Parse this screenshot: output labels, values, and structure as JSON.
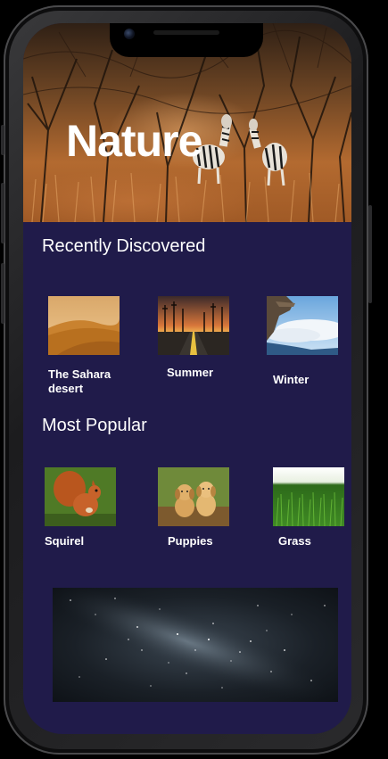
{
  "hero": {
    "title": "Nature",
    "image_icon": "savanna-zebras-image"
  },
  "recently_discovered": {
    "title": "Recently Discovered",
    "items": [
      {
        "label": "The Sahara\n desert",
        "image_icon": "desert-dunes-image"
      },
      {
        "label": "Summer",
        "image_icon": "sunset-road-image"
      },
      {
        "label": "Winter",
        "image_icon": "cliff-clouds-image"
      }
    ]
  },
  "most_popular": {
    "title": "Most Popular",
    "items": [
      {
        "label": "Squirel",
        "image_icon": "squirrel-image"
      },
      {
        "label": "Puppies",
        "image_icon": "puppies-image"
      },
      {
        "label": "Grass",
        "image_icon": "grass-image"
      }
    ]
  },
  "banner": {
    "image_icon": "milky-way-image"
  },
  "colors": {
    "background": "#201b4a",
    "text": "#ffffff",
    "frame": "#1c1c1e"
  }
}
